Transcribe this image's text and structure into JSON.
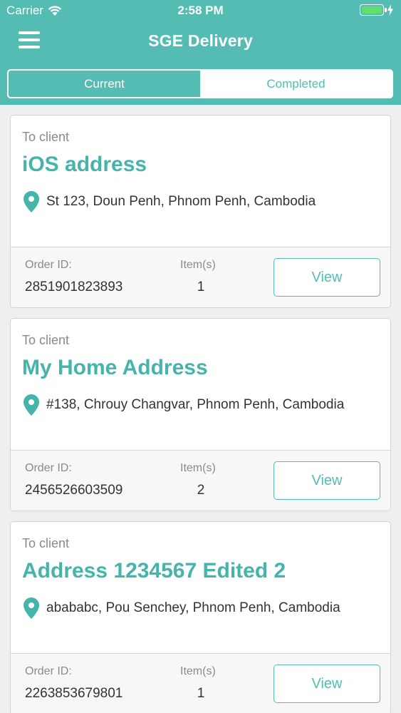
{
  "status_bar": {
    "carrier": "Carrier",
    "time": "2:58 PM"
  },
  "navbar": {
    "title": "SGE Delivery"
  },
  "tabs": [
    {
      "label": "Current",
      "active": true
    },
    {
      "label": "Completed",
      "active": false
    }
  ],
  "colors": {
    "primary": "#54bcb2",
    "title_text": "#45b4aa",
    "battery": "#5fe06b"
  },
  "orders": [
    {
      "to_label": "To client",
      "name": "iOS address",
      "address": "St 123, Doun Penh, Phnom Penh, Cambodia",
      "order_id_label": "Order ID:",
      "order_id": "2851901823893",
      "items_label": "Item(s)",
      "items": "1",
      "view_label": "View"
    },
    {
      "to_label": "To client",
      "name": "My Home Address",
      "address": "#138, Chrouy Changvar, Phnom Penh, Cambodia",
      "order_id_label": "Order ID:",
      "order_id": "2456526603509",
      "items_label": "Item(s)",
      "items": "2",
      "view_label": "View"
    },
    {
      "to_label": "To client",
      "name": "Address 1234567 Edited 2",
      "address": "abababc, Pou Senchey, Phnom Penh, Cambodia",
      "order_id_label": "Order ID:",
      "order_id": "2263853679801",
      "items_label": "Item(s)",
      "items": "1",
      "view_label": "View"
    }
  ]
}
